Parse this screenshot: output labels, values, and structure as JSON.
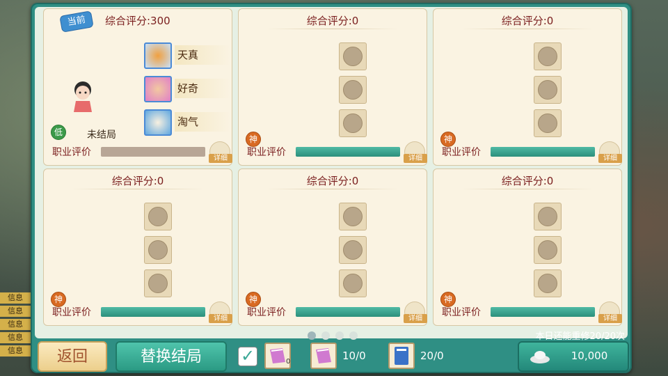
{
  "cards": [
    {
      "score_label": "综合评分:300",
      "current_tag": "当前",
      "traits": [
        "天真",
        "好奇",
        "淘气"
      ],
      "status_badge": "低",
      "status_text": "未结局",
      "eval_label": "职业评价",
      "detail_label": "详细",
      "bar_color": "#b8a696"
    },
    {
      "score_label": "综合评分:0",
      "badge": "神",
      "eval_label": "职业评价",
      "detail_label": "详细",
      "bar_color": "#3aa896"
    },
    {
      "score_label": "综合评分:0",
      "badge": "神",
      "eval_label": "职业评价",
      "detail_label": "详细",
      "bar_color": "#3aa896"
    },
    {
      "score_label": "综合评分:0",
      "badge": "神",
      "eval_label": "职业评价",
      "detail_label": "详细",
      "bar_color": "#3aa896"
    },
    {
      "score_label": "综合评分:0",
      "badge": "神",
      "eval_label": "职业评价",
      "detail_label": "详细",
      "bar_color": "#3aa896"
    },
    {
      "score_label": "综合评分:0",
      "badge": "神",
      "eval_label": "职业评价",
      "detail_label": "详细",
      "bar_color": "#3aa896"
    }
  ],
  "pager": {
    "pages": 4,
    "active": 0
  },
  "footer": {
    "back_label": "返回",
    "replace_label": "替换结局",
    "checkbox_checked": true,
    "item1_count": "0",
    "item2_count": "10/0",
    "item3_count": "20/0",
    "repair_text": "本日还能重修20/20次",
    "money_value": "10,000"
  },
  "side_labels": [
    "信息",
    "信息",
    "信息",
    "信息",
    "信息"
  ],
  "icons": {
    "tag": "current-tag-icon",
    "money": "silver-ingot-icon",
    "check": "check-icon"
  }
}
